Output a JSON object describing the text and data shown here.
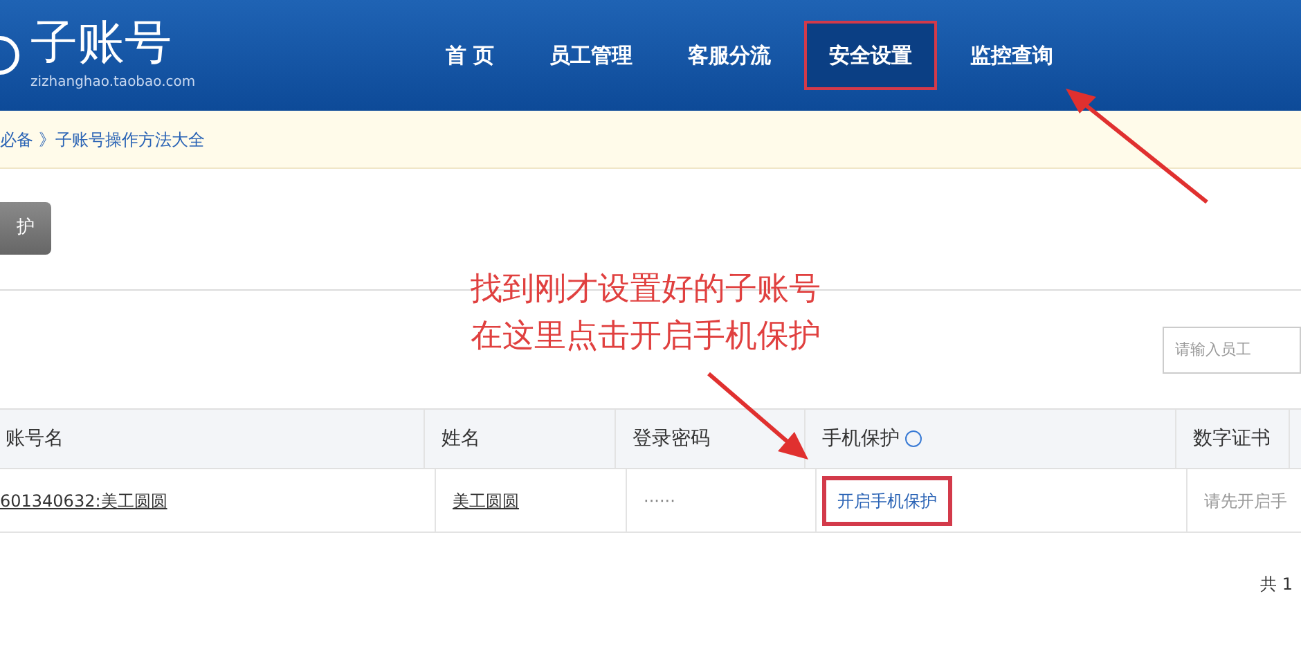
{
  "header": {
    "logo": "子账号",
    "domain": "zizhanghao.taobao.com",
    "nav": [
      {
        "label": "首 页",
        "selected": false
      },
      {
        "label": "员工管理",
        "selected": false
      },
      {
        "label": "客服分流",
        "selected": false
      },
      {
        "label": "安全设置",
        "selected": true
      },
      {
        "label": "监控查询",
        "selected": false
      }
    ]
  },
  "breadcrumb": "必备 》子账号操作方法大全",
  "toolbar": {
    "button": "护"
  },
  "annotation": [
    "找到刚才设置好的子账号",
    "在这里点击开启手机保护"
  ],
  "search": {
    "placeholder": "请输入员工"
  },
  "table": {
    "columns": [
      "账号名",
      "姓名",
      "登录密码",
      "手机保护",
      "数字证书"
    ],
    "rows": [
      {
        "account": "601340632:美工圆圆",
        "name": "美工圆圆",
        "password": "······",
        "phone_protection": "开启手机保护",
        "certificate": "请先开启手"
      }
    ]
  },
  "pagination": "共 1"
}
